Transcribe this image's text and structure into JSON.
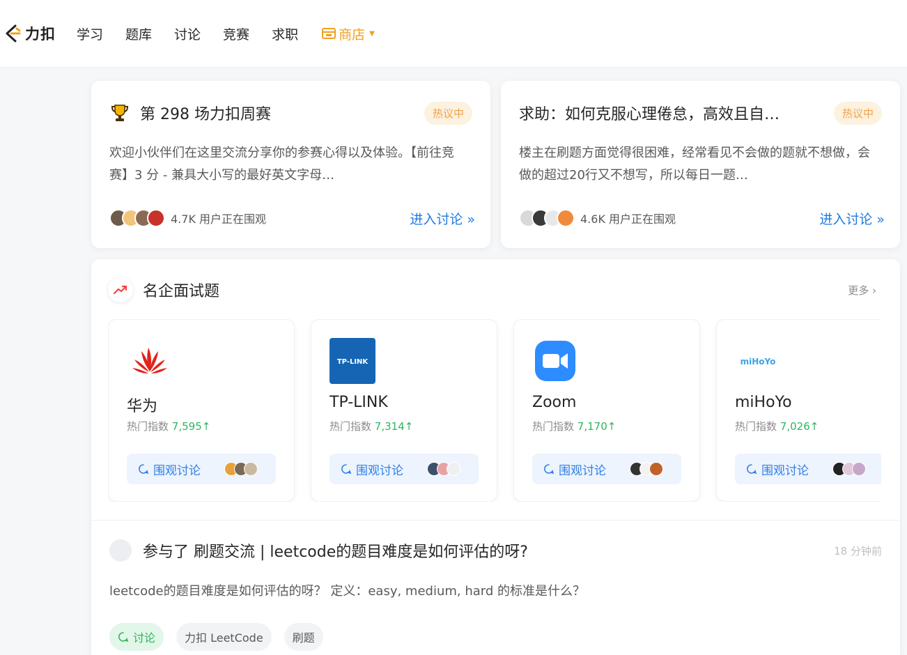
{
  "nav": {
    "logo_text": "力扣",
    "items": [
      "学习",
      "题库",
      "讨论",
      "竞赛",
      "求职"
    ],
    "store_label": "商店",
    "store_color": "#f0a020"
  },
  "hot_cards": [
    {
      "title": "第 298 场力扣周赛",
      "badge": "热议中",
      "desc": "欢迎小伙伴们在这里交流分享你的参赛心得以及体验。【前往竞赛】3 分 - 兼具大小写的最好英文字母…",
      "watch": "4.7K 用户正在围观",
      "enter": "进入讨论 »",
      "icon": "trophy-icon"
    },
    {
      "title": "求助：如何克服心理倦怠，高效且自…",
      "badge": "热议中",
      "desc": "楼主在刷题方面觉得很困难，经常看见不会做的题就不想做，会做的超过20行又不想写，所以每日一题…",
      "watch": "4.6K 用户正在围观",
      "enter": "进入讨论 »"
    }
  ],
  "company_section": {
    "title": "名企面试题",
    "more": "更多 ›",
    "hot_label": "热门指数",
    "button_label": "围观讨论",
    "companies": [
      {
        "name": "华为",
        "hot": "7,595↑",
        "logo": "huawei-logo"
      },
      {
        "name": "TP-LINK",
        "hot": "7,314↑",
        "logo": "tplink-logo",
        "logo_text": "TP-LINK"
      },
      {
        "name": "Zoom",
        "hot": "7,170↑",
        "logo": "zoom-logo"
      },
      {
        "name": "miHoYo",
        "hot": "7,026↑",
        "logo": "mihoyo-logo",
        "logo_text": "miHoYo"
      }
    ]
  },
  "activity": {
    "title": "参与了 刷题交流 | leetcode的题目难度是如何评估的呀?",
    "time": "18 分钟前",
    "desc": "leetcode的题目难度是如何评估的呀？ 定义：easy, medium, hard 的标准是什么？",
    "tags": [
      "讨论",
      "力扣 LeetCode",
      "刷题"
    ]
  },
  "colors": {
    "link": "#1f7ae0",
    "hot_green": "#2db55d",
    "badge_bg": "#fdf1e0",
    "badge_text": "#f0a34a"
  }
}
